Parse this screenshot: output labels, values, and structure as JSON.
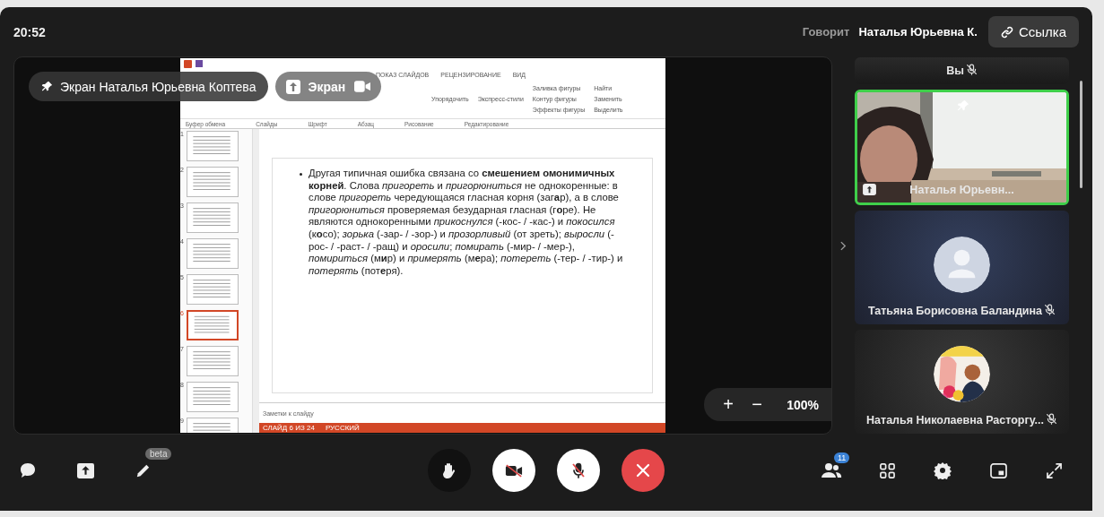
{
  "top_bar": {
    "time": "20:52",
    "speaker_label": "Говорит",
    "speaker_name": "Наталья Юрьевна К.",
    "link_button": "Ссылка"
  },
  "stage": {
    "screen_badge": "Экран Наталья Юрьевна Коптева",
    "screen_button": "Экран",
    "zoom": {
      "plus": "+",
      "minus": "−",
      "value": "100%"
    },
    "presentation": {
      "tabs": [
        "ПОКАЗ СЛАЙДОВ",
        "РЕЦЕНЗИРОВАНИЕ",
        "ВИД"
      ],
      "ribbon_buttons": [
        "Упорядочить",
        "Экспресс-стили",
        "Заливка фигуры",
        "Контур фигуры",
        "Эффекты фигуры",
        "Найти",
        "Заменить",
        "Выделить"
      ],
      "ribbon_groups": [
        "Буфер обмена",
        "Слайды",
        "Шрифт",
        "Абзац",
        "Рисование",
        "Редактирование"
      ],
      "thumbnails": [
        {
          "number": "1",
          "selected": false
        },
        {
          "number": "2",
          "selected": false
        },
        {
          "number": "3",
          "selected": false
        },
        {
          "number": "4",
          "selected": false
        },
        {
          "number": "5",
          "selected": false
        },
        {
          "number": "6",
          "selected": true
        },
        {
          "number": "7",
          "selected": false
        },
        {
          "number": "8",
          "selected": false
        },
        {
          "number": "9",
          "selected": false
        }
      ],
      "slide_text": "Другая типичная ошибка связана со **смешением омонимичных корней**. Слова *пригореть* и *пригорюниться* не однокоренные: в слове *пригореть* чередующаяся гласная корня (заг**а**р), а в слове *пригорюниться* проверяемая безударная гласная (г**о**ре). Не являются однокоренными *прикоснулся* (-кос- / -кас-) и *покосился* (к**о**со); *зорька* (-зар- / -зор-) и *прозорливый* (от зреть); *выросли* (-рос- / -раст- / -ращ) и *оросили*; *помирать* (-мир- / -мер-), *помириться* (м**и**р) и *примерять* (м**е**ра); *потереть* (-тер- / -тир-) и *потерять* (пот**е**ря).",
      "notes_placeholder": "Заметки к слайду",
      "status": [
        "СЛАЙД 6 ИЗ 24",
        "РУССКИЙ"
      ]
    }
  },
  "participants": [
    {
      "name": "Вы",
      "kind": "self",
      "muted": true,
      "speaking": false
    },
    {
      "name": "Наталья Юрьевн...",
      "kind": "video",
      "muted": false,
      "speaking": true,
      "pinned": true,
      "sharing": true
    },
    {
      "name": "Татьяна Борисовна Баландина",
      "kind": "avatar",
      "muted": true,
      "speaking": false
    },
    {
      "name": "Наталья Николаевна Расторгу...",
      "muted": true,
      "speaking": false
    }
  ],
  "toolbar": {
    "beta_badge": "beta",
    "participants_count": "11"
  }
}
